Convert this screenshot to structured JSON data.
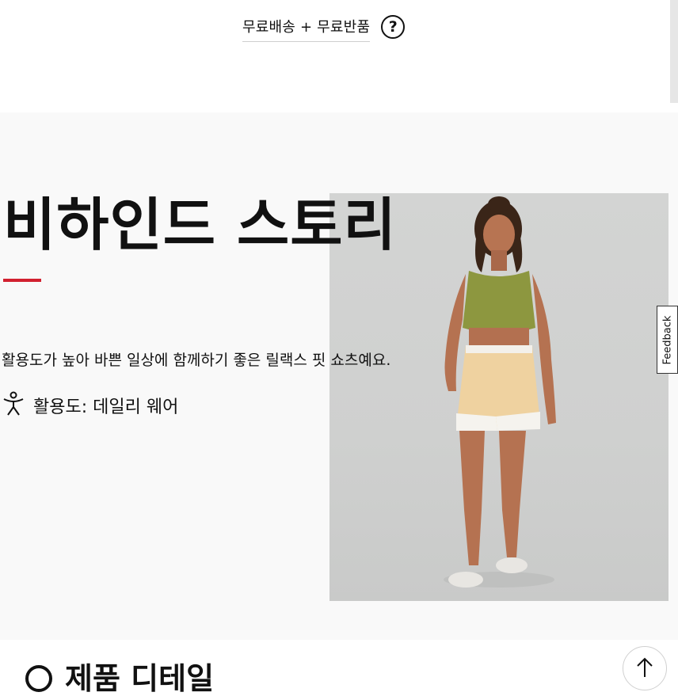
{
  "header": {
    "shipping_label": "무료배송 + 무료반품",
    "help_icon": "question-circle-icon"
  },
  "story": {
    "title": "비하인드 스토리",
    "accent_color": "#d22030",
    "description": "활용도가 높아 바쁜 일상에 함께하기 좋은 릴랙스 핏 쇼츠예요.",
    "activity_icon": "person-activity-icon",
    "activity_label": "활용도: 데일리 웨어",
    "image": "model-wearing-olive-crop-top-and-yellow-shorts"
  },
  "feedback_tab": {
    "label": "Feedback"
  },
  "next_section": {
    "title": "제품 디테일"
  },
  "back_to_top_icon": "arrow-up-icon"
}
